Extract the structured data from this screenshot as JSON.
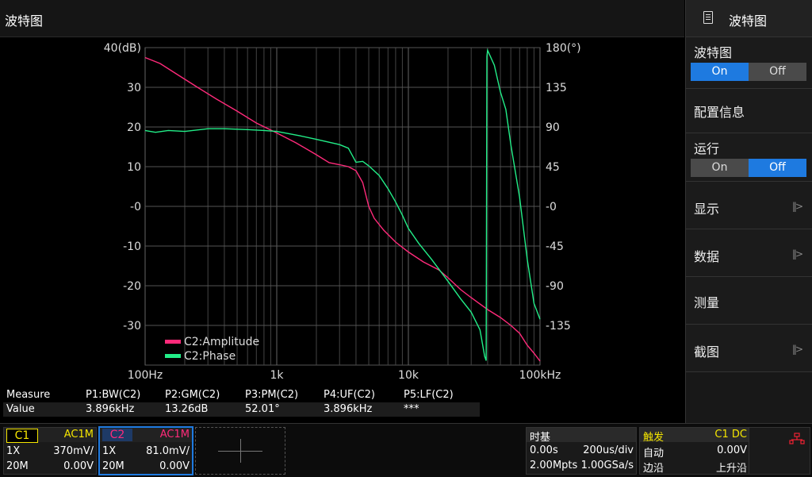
{
  "title": "波特图",
  "menu": {
    "header": {
      "icon": "document-icon",
      "label": "波特图"
    },
    "bode": {
      "label": "波特图",
      "on": "On",
      "off": "Off",
      "selected": "On"
    },
    "config": {
      "label": "配置信息"
    },
    "run": {
      "label": "运行",
      "on": "On",
      "off": "Off",
      "selected": "Off"
    },
    "display": {
      "label": "显示",
      "arrow": "||>"
    },
    "data": {
      "label": "数据",
      "arrow": "||>"
    },
    "measure": {
      "label": "测量"
    },
    "screenshot": {
      "label": "截图",
      "arrow": "||>"
    }
  },
  "chart_data": {
    "type": "line",
    "x_scale": "log",
    "xlim": [
      100,
      100000
    ],
    "x_ticks": [
      {
        "v": 100,
        "label": "100Hz"
      },
      {
        "v": 1000,
        "label": "1k"
      },
      {
        "v": 10000,
        "label": "10k"
      },
      {
        "v": 100000,
        "label": "100kHz"
      }
    ],
    "ylim_left": [
      -40,
      40
    ],
    "y_ticks_left": [
      {
        "v": 40,
        "label": "40(dB)"
      },
      {
        "v": 30,
        "label": "30"
      },
      {
        "v": 20,
        "label": "20"
      },
      {
        "v": 10,
        "label": "10"
      },
      {
        "v": 0,
        "label": "-0"
      },
      {
        "v": -10,
        "label": "-10"
      },
      {
        "v": -20,
        "label": "-20"
      },
      {
        "v": -30,
        "label": "-30"
      }
    ],
    "ylim_right": [
      -180,
      180
    ],
    "y_ticks_right": [
      {
        "v": 180,
        "label": "180(°)"
      },
      {
        "v": 135,
        "label": "135"
      },
      {
        "v": 90,
        "label": "90"
      },
      {
        "v": 45,
        "label": "45"
      },
      {
        "v": 0,
        "label": "-0"
      },
      {
        "v": -45,
        "label": "-45"
      },
      {
        "v": -90,
        "label": "-90"
      },
      {
        "v": -135,
        "label": "-135"
      }
    ],
    "grid": true,
    "legend": "bottom-left",
    "series": [
      {
        "name": "C2:Amplitude",
        "color": "#ff2a7a",
        "axis": "left",
        "points": [
          [
            100,
            37.5
          ],
          [
            130,
            36
          ],
          [
            180,
            33
          ],
          [
            250,
            30
          ],
          [
            350,
            27
          ],
          [
            500,
            24
          ],
          [
            700,
            21
          ],
          [
            1000,
            18.5
          ],
          [
            1400,
            16
          ],
          [
            2000,
            13
          ],
          [
            2500,
            11
          ],
          [
            3000,
            10.5
          ],
          [
            3500,
            10
          ],
          [
            4000,
            9
          ],
          [
            4500,
            6
          ],
          [
            5000,
            0
          ],
          [
            5500,
            -3
          ],
          [
            6500,
            -6
          ],
          [
            8000,
            -9
          ],
          [
            10000,
            -11.5
          ],
          [
            13000,
            -14
          ],
          [
            17000,
            -16
          ],
          [
            20000,
            -18
          ],
          [
            25000,
            -21
          ],
          [
            30000,
            -23
          ],
          [
            40000,
            -26
          ],
          [
            50000,
            -28
          ],
          [
            60000,
            -30
          ],
          [
            70000,
            -32
          ],
          [
            80000,
            -35
          ],
          [
            90000,
            -37
          ],
          [
            100000,
            -39
          ]
        ]
      },
      {
        "name": "C2:Phase",
        "color": "#22ee88",
        "axis": "right",
        "points": [
          [
            100,
            86
          ],
          [
            120,
            84
          ],
          [
            150,
            86
          ],
          [
            200,
            85
          ],
          [
            300,
            88
          ],
          [
            400,
            88
          ],
          [
            600,
            87
          ],
          [
            800,
            86
          ],
          [
            1000,
            85
          ],
          [
            1500,
            80
          ],
          [
            2000,
            76
          ],
          [
            3000,
            70
          ],
          [
            3500,
            66
          ],
          [
            4000,
            50
          ],
          [
            4500,
            51
          ],
          [
            5000,
            46
          ],
          [
            6000,
            35
          ],
          [
            7000,
            20
          ],
          [
            8000,
            5
          ],
          [
            9000,
            -10
          ],
          [
            10000,
            -25
          ],
          [
            12000,
            -42
          ],
          [
            15000,
            -60
          ],
          [
            20000,
            -85
          ],
          [
            25000,
            -105
          ],
          [
            30000,
            -120
          ],
          [
            35000,
            -140
          ],
          [
            38000,
            -170
          ],
          [
            39000,
            -175
          ],
          [
            39500,
            170
          ],
          [
            40000,
            177
          ],
          [
            45000,
            160
          ],
          [
            50000,
            130
          ],
          [
            55000,
            110
          ],
          [
            60000,
            70
          ],
          [
            70000,
            10
          ],
          [
            80000,
            -60
          ],
          [
            90000,
            -110
          ],
          [
            100000,
            -128
          ]
        ]
      }
    ]
  },
  "measure": {
    "header": [
      "Measure",
      "P1:BW(C2)",
      "P2:GM(C2)",
      "P3:PM(C2)",
      "P4:UF(C2)",
      "P5:LF(C2)"
    ],
    "values": [
      "Value",
      "3.896kHz",
      "13.26dB",
      "52.01°",
      "3.896kHz",
      "***"
    ]
  },
  "channels": {
    "c1": {
      "name": "C1",
      "coupling": "AC1M",
      "probe": "1X",
      "scale": "370mV/",
      "bw": "20M",
      "offset": "0.00V",
      "color": "#f5e600"
    },
    "c2": {
      "name": "C2",
      "coupling": "AC1M",
      "probe": "1X",
      "scale": "81.0mV/",
      "bw": "20M",
      "offset": "0.00V",
      "color": "#ff2a7a"
    }
  },
  "timebase": {
    "label": "时基",
    "delay": "0.00s",
    "scale": "200us/div",
    "points": "2.00Mpts",
    "rate": "1.00GSa/s"
  },
  "trigger": {
    "label": "触发",
    "source": "C1 DC",
    "mode": "自动",
    "level": "0.00V",
    "type": "边沿",
    "slope": "上升沿"
  },
  "usb_icon": "usb-icon"
}
